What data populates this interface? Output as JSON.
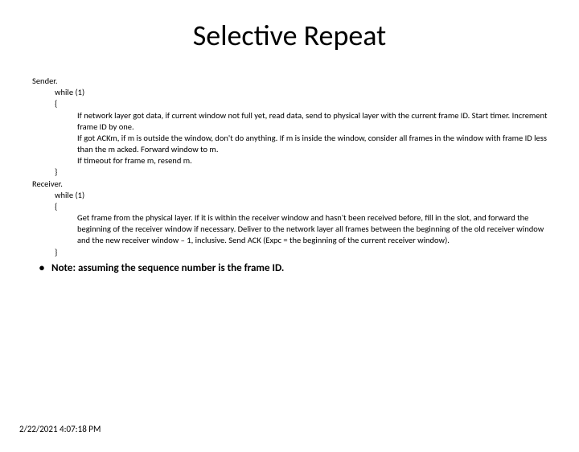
{
  "title": "Selective Repeat",
  "sender_label": "Sender.",
  "while_line": "while (1)",
  "brace_open": "{",
  "brace_close": "}",
  "sender_body": [
    "If network layer got data, if current window not full yet, read data, send to physical layer with the current frame ID. Start timer. Increment frame ID by one.",
    "If got ACKm, if m is outside the window, don't do anything. If m is inside the window, consider all frames in the window with frame ID less than the m acked. Forward window to m.",
    "If timeout for frame m, resend m."
  ],
  "receiver_label": "Receiver.",
  "receiver_body": [
    "Get frame from the physical layer. If it is within the receiver window and hasn't been received before, fill in the slot, and forward the beginning of the receiver window if necessary.  Deliver to the network layer all frames between the beginning of the old receiver window and the new receiver window – 1, inclusive. Send ACK (Expc = the beginning of the current receiver window)."
  ],
  "note_bullet": "•",
  "note_text": "Note: assuming the sequence number is the frame ID.",
  "footer": "2/22/2021 4:07:18 PM"
}
